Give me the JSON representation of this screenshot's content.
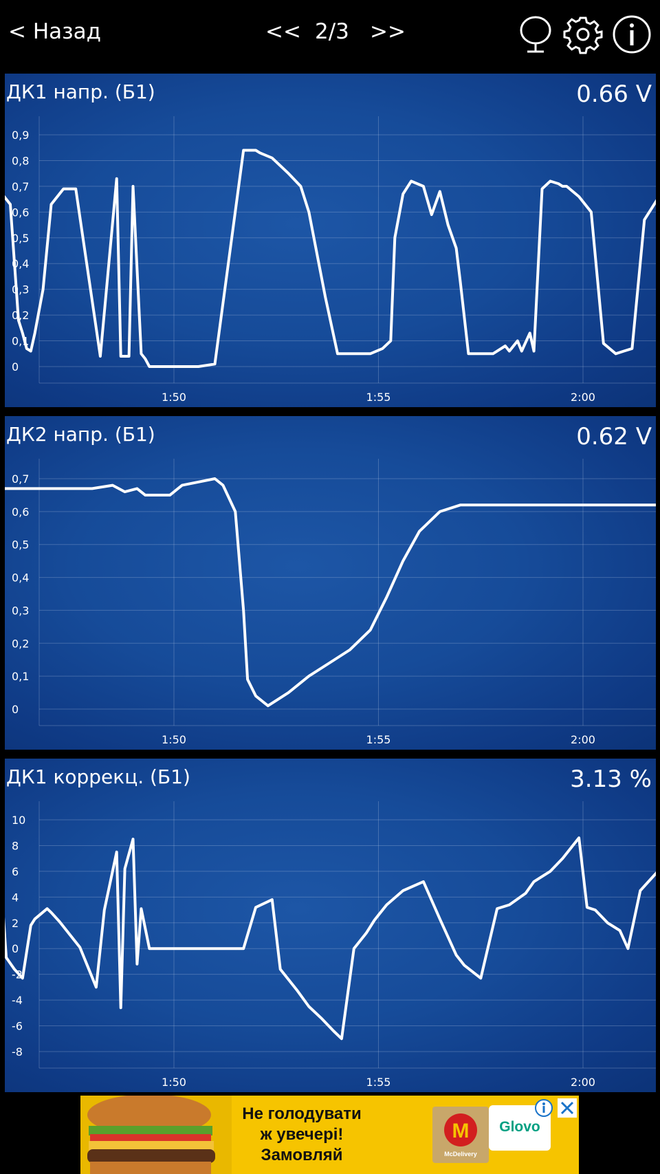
{
  "header": {
    "back_label": "< Назад",
    "prev_label": "<<",
    "page_label": "2/3",
    "next_label": ">>",
    "icons": [
      "mirror-icon",
      "gear-icon",
      "info-icon"
    ]
  },
  "colors": {
    "panel_blue": "#164b99",
    "line": "#ffffff",
    "ad_yellow": "#f6c400"
  },
  "panels": [
    {
      "title": "ДК1 напр. (Б1)",
      "value": "0.66 V",
      "chart_data": {
        "type": "line",
        "xlabel": "",
        "ylabel": "",
        "xticks": [
          "1:50",
          "1:55",
          "2:00"
        ],
        "yticks": [
          "0,9",
          "0,8",
          "0,7",
          "0,6",
          "0,5",
          "0,4",
          "0,3",
          "0,2",
          "0,1",
          "0"
        ],
        "ylim": [
          0,
          0.9
        ],
        "xlim_seconds": [
          104.2,
          124.0
        ],
        "grid": true,
        "series": [
          {
            "x": [
              104.2,
              104.4,
              104.5,
              104.6,
              104.7,
              104.8,
              104.9,
              105.0,
              105.1,
              105.2,
              105.5,
              105.7,
              105.8,
              106.0,
              106.2,
              106.3,
              106.4,
              106.5,
              106.6,
              106.8,
              107.0,
              107.3,
              107.6,
              108.2,
              108.6,
              108.7,
              108.9,
              109.0,
              109.2,
              109.3,
              109.4,
              109.6,
              109.8,
              110.0,
              110.3,
              110.6,
              111.0,
              111.7,
              112.0,
              112.1,
              112.4,
              112.8,
              113.1,
              113.3,
              113.7,
              114.0,
              114.2,
              114.4,
              114.8,
              115.1,
              115.3,
              115.4,
              115.6,
              115.8,
              116.1,
              116.3,
              116.5,
              116.7,
              116.9,
              117.0,
              117.2,
              117.4,
              117.8,
              118.1,
              118.2,
              118.4,
              118.5,
              118.7,
              118.8,
              119.0,
              119.2,
              119.4,
              119.5,
              119.6,
              119.9,
              120.2,
              120.5,
              120.8,
              121.0,
              121.2,
              121.5,
              121.9,
              122.1,
              122.3,
              122.4,
              122.5,
              122.7,
              122.9,
              123.0,
              123.1,
              123.4,
              123.7,
              123.9,
              124.0
            ],
            "y": [
              0.52,
              0.61,
              0.13,
              0.18,
              0.1,
              0.18,
              0.12,
              0.15,
              0.54,
              0.31,
              0.67,
              0.64,
              0.67,
              0.63,
              0.18,
              0.13,
              0.07,
              0.06,
              0.13,
              0.3,
              0.63,
              0.69,
              0.69,
              0.04,
              0.73,
              0.04,
              0.04,
              0.7,
              0.05,
              0.03,
              0.0,
              0.0,
              0.0,
              0.0,
              0.0,
              0.0,
              0.01,
              0.84,
              0.84,
              0.83,
              0.81,
              0.75,
              0.7,
              0.6,
              0.27,
              0.05,
              0.05,
              0.05,
              0.05,
              0.07,
              0.1,
              0.5,
              0.67,
              0.72,
              0.7,
              0.59,
              0.68,
              0.55,
              0.46,
              0.33,
              0.05,
              0.05,
              0.05,
              0.08,
              0.06,
              0.1,
              0.06,
              0.13,
              0.06,
              0.69,
              0.72,
              0.71,
              0.7,
              0.7,
              0.66,
              0.6,
              0.09,
              0.05,
              0.06,
              0.07,
              0.57,
              0.67,
              0.56,
              0.47,
              0.12,
              0.1,
              0.07,
              0.06,
              0.06,
              0.19,
              0.55,
              0.65,
              0.66,
              0.66
            ]
          }
        ]
      }
    },
    {
      "title": "ДК2 напр. (Б1)",
      "value": "0.62 V",
      "chart_data": {
        "type": "line",
        "xlabel": "",
        "ylabel": "",
        "xticks": [
          "1:50",
          "1:55",
          "2:00"
        ],
        "yticks": [
          "0,7",
          "0,6",
          "0,5",
          "0,4",
          "0,3",
          "0,2",
          "0,1",
          "0"
        ],
        "ylim": [
          0,
          0.7
        ],
        "xlim_seconds": [
          104.2,
          124.0
        ],
        "grid": true,
        "series": [
          {
            "x": [
              104.2,
              105.0,
              106.0,
              107.0,
              108.0,
              108.5,
              108.8,
              109.1,
              109.3,
              109.5,
              109.6,
              109.9,
              110.2,
              110.6,
              111.0,
              111.2,
              111.5,
              111.7,
              111.8,
              112.0,
              112.3,
              112.8,
              113.3,
              113.8,
              114.3,
              114.8,
              115.2,
              115.6,
              116.0,
              116.5,
              117.0,
              117.5,
              118.0,
              119.0,
              120.0,
              121.0,
              122.0,
              123.0,
              124.0
            ],
            "y": [
              0.68,
              0.67,
              0.67,
              0.67,
              0.67,
              0.68,
              0.66,
              0.67,
              0.65,
              0.65,
              0.65,
              0.65,
              0.68,
              0.69,
              0.7,
              0.68,
              0.6,
              0.3,
              0.09,
              0.04,
              0.01,
              0.05,
              0.1,
              0.14,
              0.18,
              0.24,
              0.34,
              0.45,
              0.54,
              0.6,
              0.62,
              0.62,
              0.62,
              0.62,
              0.62,
              0.62,
              0.62,
              0.62,
              0.62
            ]
          }
        ]
      }
    },
    {
      "title": "ДК1 коррекц. (Б1)",
      "value": "3.13 %",
      "chart_data": {
        "type": "line",
        "xlabel": "",
        "ylabel": "",
        "xticks": [
          "1:50",
          "1:55",
          "2:00"
        ],
        "yticks": [
          "10",
          "8",
          "6",
          "4",
          "2",
          "0",
          "-2",
          "-4",
          "-6",
          "-8"
        ],
        "ylim": [
          -8,
          10
        ],
        "xlim_seconds": [
          104.2,
          124.0
        ],
        "grid": true,
        "series": [
          {
            "x": [
              104.2,
              104.4,
              104.6,
              104.9,
              105.2,
              105.5,
              105.7,
              105.8,
              105.9,
              106.1,
              106.3,
              106.5,
              106.6,
              106.9,
              107.0,
              107.2,
              107.7,
              108.1,
              108.3,
              108.6,
              108.7,
              108.8,
              109.0,
              109.1,
              109.2,
              109.4,
              109.6,
              110.0,
              110.6,
              111.1,
              111.7,
              112.0,
              112.4,
              112.6,
              113.0,
              113.3,
              113.6,
              113.9,
              114.1,
              114.4,
              114.7,
              114.9,
              115.0,
              115.2,
              115.6,
              116.1,
              116.5,
              116.9,
              117.1,
              117.5,
              117.9,
              118.2,
              118.6,
              118.8,
              119.2,
              119.5,
              119.9,
              120.1,
              120.3,
              120.6,
              120.9,
              121.1,
              121.4,
              121.6,
              121.8,
              122.1,
              122.3,
              122.5,
              122.7,
              123.0,
              123.1,
              123.3,
              123.6,
              123.8,
              124.0
            ],
            "y": [
              -0.8,
              -1.5,
              3.1,
              3.2,
              4.3,
              4.6,
              -0.7,
              3.9,
              -0.7,
              -1.6,
              -2.3,
              1.8,
              2.3,
              3.1,
              2.8,
              2.1,
              0.1,
              -3.0,
              3.0,
              7.5,
              -4.6,
              6.2,
              8.5,
              -1.2,
              3.1,
              0.0,
              0.0,
              0.0,
              0.0,
              0.0,
              0.0,
              3.2,
              3.8,
              -1.6,
              -3.2,
              -4.5,
              -5.4,
              -6.4,
              -7.0,
              0.0,
              1.2,
              2.2,
              2.6,
              3.4,
              4.5,
              5.2,
              2.3,
              -0.5,
              -1.3,
              -2.3,
              3.1,
              3.4,
              4.3,
              5.2,
              6.0,
              7.0,
              8.6,
              3.2,
              3.0,
              2.0,
              1.4,
              0.0,
              4.5,
              5.2,
              5.9,
              7.1,
              2.5,
              1.9,
              0.8,
              5.4,
              6.2,
              6.8,
              7.8,
              7.9,
              3.1
            ]
          }
        ]
      }
    }
  ],
  "ad": {
    "line1": "Не голодувати",
    "line2": "ж увечері!",
    "line3": "Замовляй",
    "mcd_label": "McDelivery",
    "glovo_label": "Glovo"
  }
}
